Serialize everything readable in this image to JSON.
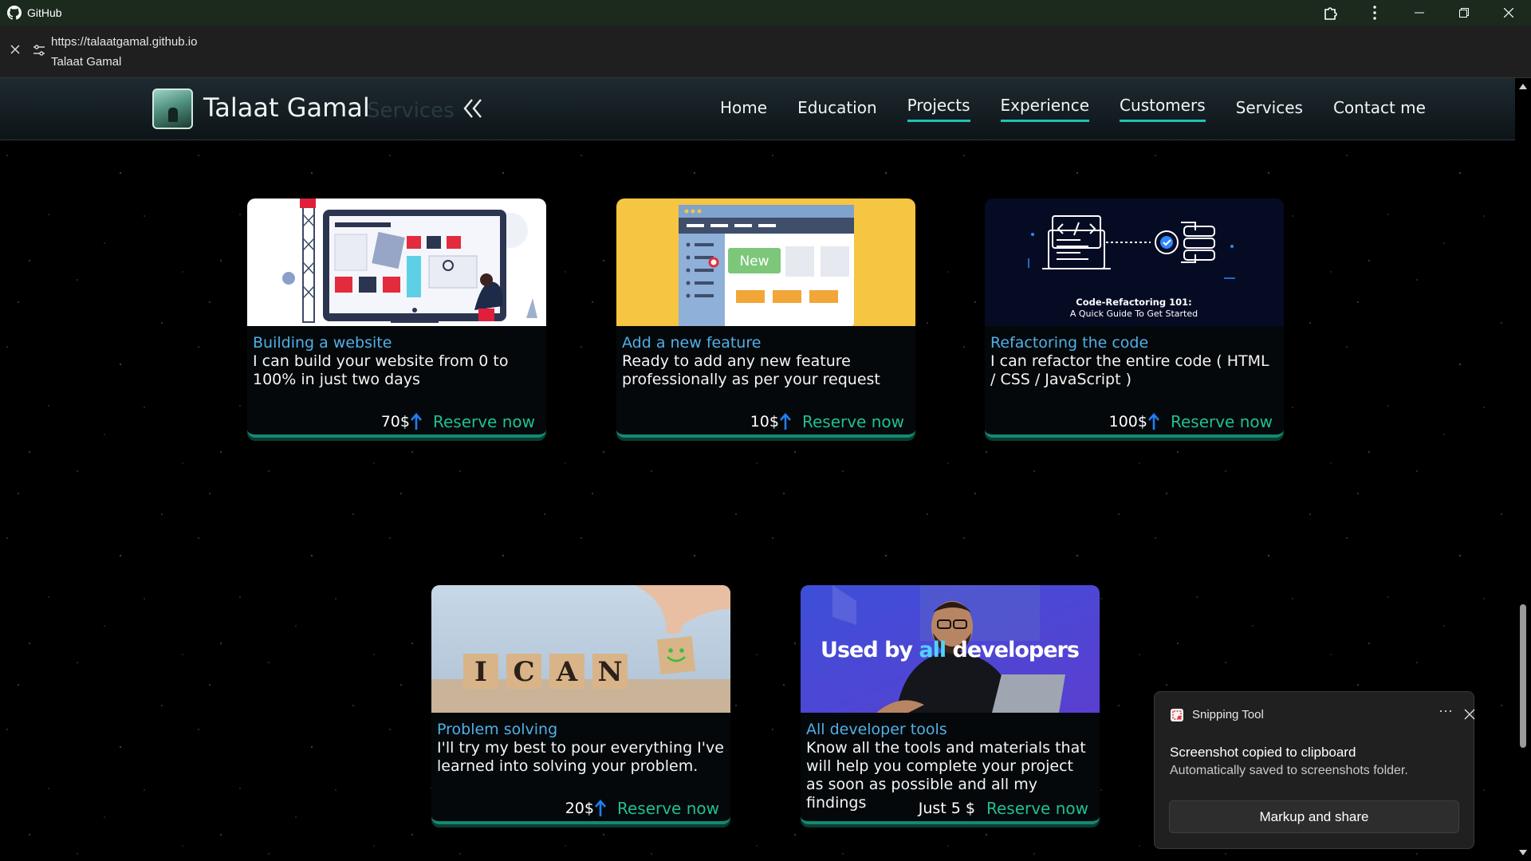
{
  "browser": {
    "app_name": "GitHub",
    "url": "https://talaatgamal.github.io",
    "page_title": "Talaat Gamal"
  },
  "site": {
    "brand_name": "Talaat Gamal",
    "ghost_label": "Services",
    "nav": [
      {
        "label": "Home",
        "active": false
      },
      {
        "label": "Education",
        "active": false
      },
      {
        "label": "Projects",
        "active": true
      },
      {
        "label": "Experience",
        "active": true
      },
      {
        "label": "Customers",
        "active": true
      },
      {
        "label": "Services",
        "active": false
      },
      {
        "label": "Contact me",
        "active": false
      }
    ]
  },
  "cards": [
    {
      "title": "Building a website",
      "description": "I can build your website from 0 to 100% in just two days",
      "price": "70$",
      "cta": "Reserve now",
      "image": "website-builder-illustration"
    },
    {
      "title": "Add a new feature",
      "description": "Ready to add any new feature professionally as per your request",
      "price": "10$",
      "cta": "Reserve now",
      "image": "new-feature-illustration",
      "image_text": "New"
    },
    {
      "title": "Refactoring the code",
      "description": "I can refactor the entire code ( HTML / CSS / JavaScript )",
      "price": "100$",
      "cta": "Reserve now",
      "image": "code-refactoring-graphic",
      "image_heading": "Code-Refactoring 101:",
      "image_subheading": "A Quick Guide To Get Started"
    },
    {
      "title": "Problem solving",
      "description": "I'll try my best to pour everything I've learned into solving your problem.",
      "price": "20$",
      "cta": "Reserve now",
      "image": "i-can-blocks-photo",
      "image_letters": [
        "I",
        "C",
        "A",
        "N"
      ]
    },
    {
      "title": "All developer tools",
      "description": "Know all the tools and materials that will help you complete your project as soon as possible and all my findings",
      "price": "Just 5 $",
      "cta": "Reserve now",
      "image": "developer-photo",
      "image_text_part1": "Used by ",
      "image_text_highlight": "all",
      "image_text_part2": " developers"
    }
  ],
  "toast": {
    "app": "Snipping Tool",
    "more": "···",
    "message": "Screenshot copied to clipboard",
    "detail": "Automatically saved to screenshots folder.",
    "button": "Markup and share"
  },
  "colors": {
    "accent_teal": "#23c0b5",
    "title_blue": "#4fb0e8",
    "cta_green": "#1fbf96",
    "arrow_blue": "#1e7ff0"
  }
}
